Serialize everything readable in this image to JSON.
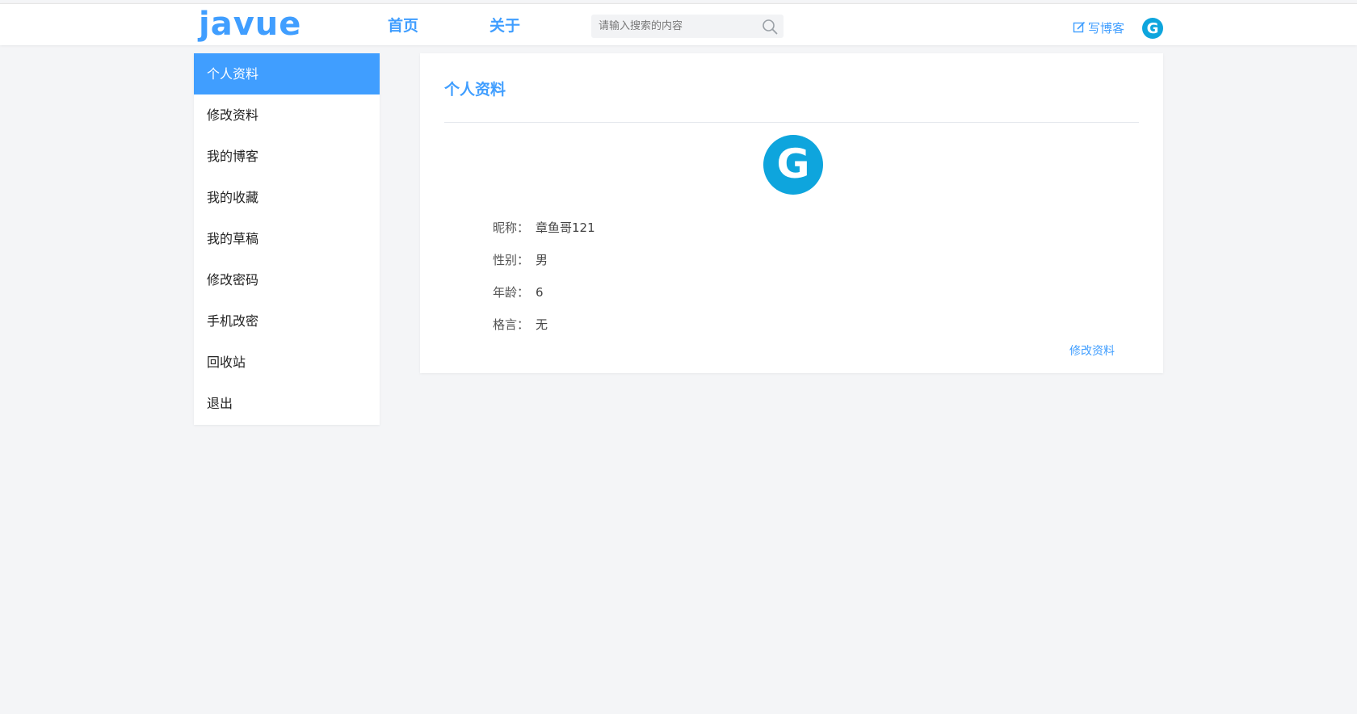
{
  "colors": {
    "accent": "#409eff",
    "avatar": "#0ea5dd",
    "background": "#f4f5f7"
  },
  "header": {
    "logo": "javue",
    "nav": {
      "home": "首页",
      "about": "关于"
    },
    "search": {
      "placeholder": "请输入搜索的内容",
      "icon": "search-icon"
    },
    "write_blog": "写博客",
    "avatar_letter": "G"
  },
  "sidebar": {
    "items": [
      {
        "label": "个人资料",
        "active": true
      },
      {
        "label": "修改资料"
      },
      {
        "label": "我的博客"
      },
      {
        "label": "我的收藏"
      },
      {
        "label": "我的草稿"
      },
      {
        "label": "修改密码"
      },
      {
        "label": "手机改密"
      },
      {
        "label": "回收站"
      },
      {
        "label": "退出"
      }
    ]
  },
  "profile": {
    "title": "个人资料",
    "avatar_letter": "G",
    "nickname_label": "昵称：",
    "nickname": "章鱼哥121",
    "gender_label": "性别：",
    "gender": "男",
    "age_label": "年龄：",
    "age": "6",
    "motto_label": "格言：",
    "motto": "无",
    "edit_link": "修改资料"
  }
}
